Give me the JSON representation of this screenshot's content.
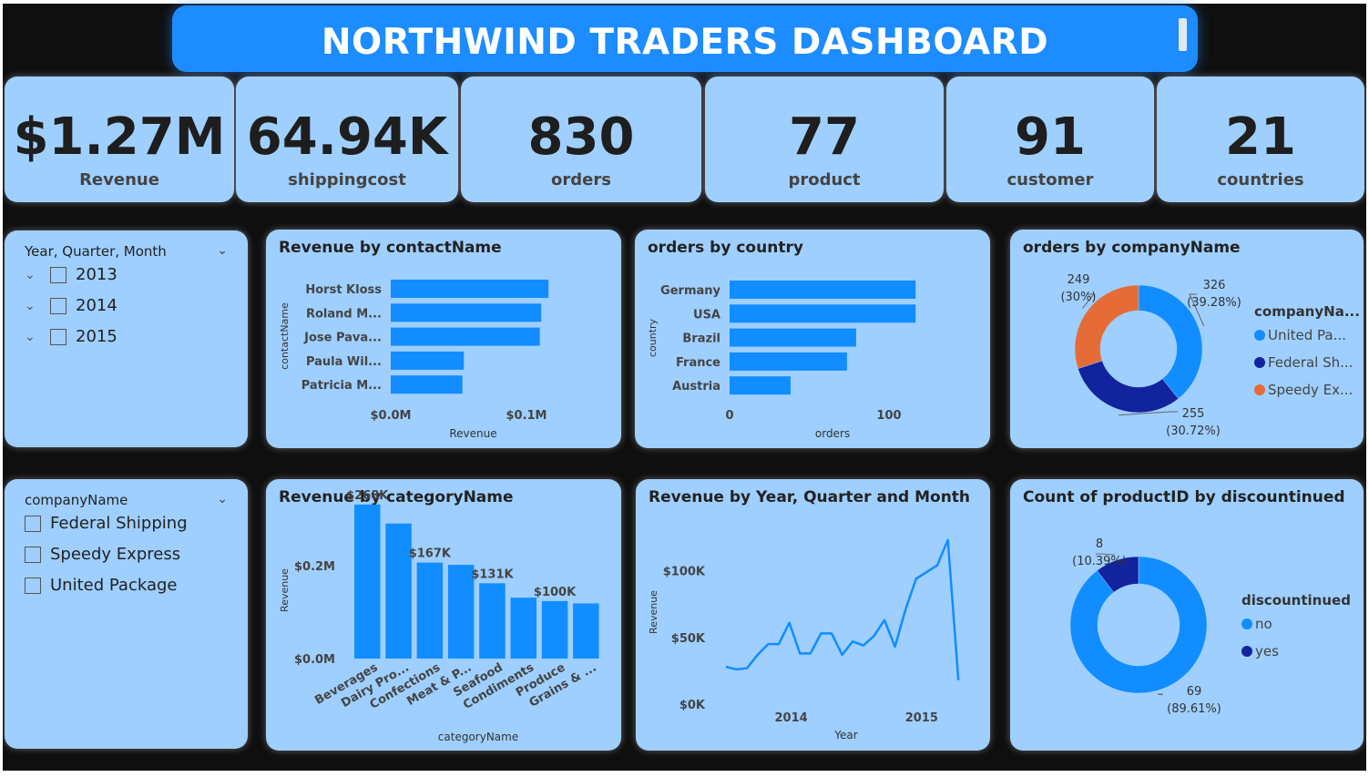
{
  "header": {
    "title": "NORTHWIND TRADERS DASHBOARD"
  },
  "kpis": [
    {
      "value": "$1.27M",
      "label": "Revenue"
    },
    {
      "value": "64.94K",
      "label": "shippingcost"
    },
    {
      "value": "830",
      "label": "orders"
    },
    {
      "value": "77",
      "label": "product"
    },
    {
      "value": "91",
      "label": "customer"
    },
    {
      "value": "21",
      "label": "countries"
    }
  ],
  "slicer_date": {
    "title": "Year, Quarter, Month",
    "items": [
      "2013",
      "2014",
      "2015"
    ]
  },
  "slicer_company": {
    "title": "companyName",
    "items": [
      "Federal Shipping",
      "Speedy Express",
      "United Package"
    ]
  },
  "colors": {
    "bar": "#118dff",
    "dark_blue": "#12239e",
    "orange": "#e66c37",
    "card": "#9fcfff",
    "header": "#1c8cff"
  },
  "chart_data": [
    {
      "type": "bar",
      "orientation": "horizontal",
      "title": "Revenue by contactName",
      "categories": [
        "Horst Kloss",
        "Roland M...",
        "Jose Pava...",
        "Paula Wil...",
        "Patricia M..."
      ],
      "values": [
        0.11,
        0.105,
        0.104,
        0.051,
        0.05
      ],
      "xlabel": "Revenue",
      "ylabel": "contactName",
      "xticks": [
        "$0.0M",
        "$0.1M"
      ],
      "xlim": [
        0,
        0.115
      ]
    },
    {
      "type": "bar",
      "orientation": "horizontal",
      "title": "orders by country",
      "categories": [
        "Germany",
        "USA",
        "Brazil",
        "France",
        "Austria"
      ],
      "values": [
        122,
        122,
        83,
        77,
        40
      ],
      "xlabel": "orders",
      "ylabel": "country",
      "xticks": [
        "0",
        "100"
      ],
      "xlim": [
        0,
        135
      ]
    },
    {
      "type": "pie",
      "donut": true,
      "title": "orders by companyName",
      "legend_title": "companyNa...",
      "legend_position": "right",
      "slices": [
        {
          "label": "United Pa...",
          "value": 326,
          "pct": "(39.28%)",
          "color": "#118dff"
        },
        {
          "label": "Federal Sh...",
          "value": 255,
          "pct": "(30.72%)",
          "color": "#12239e"
        },
        {
          "label": "Speedy Ex...",
          "value": 249,
          "pct": "(30%)",
          "color": "#e66c37"
        }
      ]
    },
    {
      "type": "bar",
      "title": "Revenue by categoryName",
      "categories": [
        "Beverages",
        "Dairy Pro...",
        "Confections",
        "Meat & P...",
        "Seafood",
        "Condiments",
        "Produce",
        "Grains & ..."
      ],
      "values": [
        268,
        235,
        167,
        163,
        131,
        106,
        100,
        96
      ],
      "data_labels": [
        "$268K",
        "",
        "$167K",
        "",
        "$131K",
        "",
        "$100K",
        ""
      ],
      "xlabel": "categoryName",
      "ylabel": "Revenue",
      "yticks": [
        "$0.0M",
        "$0.2M"
      ],
      "ylim": [
        0,
        290
      ]
    },
    {
      "type": "line",
      "title": "Revenue by Year, Quarter and Month",
      "xlabel": "Year",
      "ylabel": "Revenue",
      "xticks": [
        "2014",
        "2015"
      ],
      "yticks": [
        "$0K",
        "$50K",
        "$100K"
      ],
      "ylim": [
        0,
        125
      ],
      "x": [
        "2013-07",
        "2013-08",
        "2013-09",
        "2013-10",
        "2013-11",
        "2013-12",
        "2014-01",
        "2014-02",
        "2014-03",
        "2014-04",
        "2014-05",
        "2014-06",
        "2014-07",
        "2014-08",
        "2014-09",
        "2014-10",
        "2014-11",
        "2014-12",
        "2015-01",
        "2015-02",
        "2015-03",
        "2015-04",
        "2015-05"
      ],
      "values": [
        28,
        26,
        27,
        37,
        45,
        45,
        61,
        38,
        38,
        53,
        53,
        37,
        47,
        44,
        51,
        63,
        43,
        71,
        94,
        99,
        104,
        123,
        18
      ]
    },
    {
      "type": "pie",
      "donut": true,
      "title": "Count of productID by discountinued",
      "legend_title": "discountinued",
      "legend_position": "right",
      "slices": [
        {
          "label": "no",
          "value": 69,
          "pct": "(89.61%)",
          "color": "#118dff"
        },
        {
          "label": "yes",
          "value": 8,
          "pct": "(10.39%)",
          "color": "#12239e"
        }
      ]
    }
  ]
}
